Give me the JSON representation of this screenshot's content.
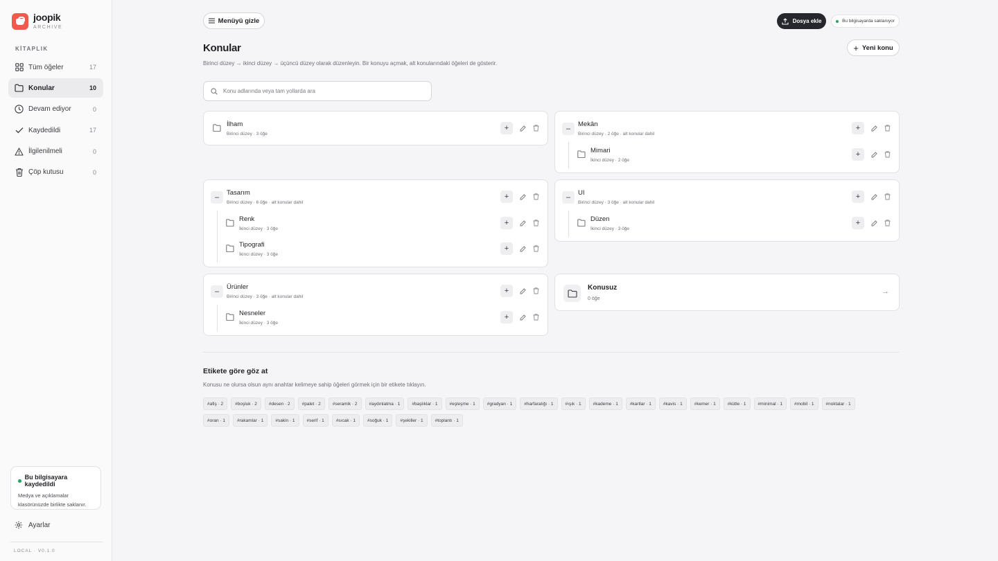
{
  "brand": {
    "name": "joopik",
    "sub": "ARCHIVE"
  },
  "sidebar": {
    "section_label": "KİTAPLIK",
    "items": [
      {
        "label": "Tüm öğeler",
        "count": "17",
        "icon": "grid-icon"
      },
      {
        "label": "Konular",
        "count": "10",
        "icon": "folder-icon",
        "active": true
      },
      {
        "label": "Devam ediyor",
        "count": "0",
        "icon": "clock-icon"
      },
      {
        "label": "Kaydedildi",
        "count": "17",
        "icon": "check-icon"
      },
      {
        "label": "İlgilenilmeli",
        "count": "0",
        "icon": "warning-icon"
      },
      {
        "label": "Çöp kutusu",
        "count": "0",
        "icon": "trash-icon"
      }
    ],
    "save_card": {
      "title": "Bu bilgisayara kaydedildi",
      "desc_line1": "Medya ve açıklamalar",
      "desc_line2": "klasörünüzde birlikte saklanır."
    },
    "settings_label": "Ayarlar",
    "version": "LOCAL · V0.1.0"
  },
  "header": {
    "menu_toggle": "Menüyü gizle",
    "upload": "Dosya ekle",
    "local_badge": "Bu bilgisayarda saklanıyor",
    "title": "Konular",
    "new_topic": "Yeni konu",
    "description": "Birinci düzey → ikinci düzey → üçüncü düzey olarak düzenleyin. Bir konuyu açmak, alt konularındaki öğeleri de gösterir."
  },
  "search": {
    "placeholder": "Konu adlarında veya tam yollarda ara"
  },
  "topics": {
    "ilham": {
      "name": "İlham",
      "meta": "Birinci düzey · 3 öğe"
    },
    "mekan": {
      "name": "Mekân",
      "meta": "Birinci düzey · 2 öğe · alt konular dahil"
    },
    "mimari": {
      "name": "Mimari",
      "meta": "İkinci düzey · 2 öğe"
    },
    "tasarim": {
      "name": "Tasarım",
      "meta": "Birinci düzey · 6 öğe · alt konular dahil"
    },
    "renk": {
      "name": "Renk",
      "meta": "İkinci düzey · 3 öğe"
    },
    "tipografi": {
      "name": "Tipografi",
      "meta": "İkinci düzey · 3 öğe"
    },
    "ui": {
      "name": "UI",
      "meta": "Birinci düzey · 3 öğe · alt konular dahil"
    },
    "duzen": {
      "name": "Düzen",
      "meta": "İkinci düzey · 3 öğe"
    },
    "urunler": {
      "name": "Ürünler",
      "meta": "Birinci düzey · 3 öğe · alt konular dahil"
    },
    "nesneler": {
      "name": "Nesneler",
      "meta": "İkinci düzey · 3 öğe"
    }
  },
  "unlabeled": {
    "name": "Konusuz",
    "meta": "0 öğe"
  },
  "tags_section": {
    "title": "Etikete göre göz at",
    "description": "Konusu ne olursa olsun aynı anahtar kelimeye sahip öğeleri görmek için bir etikete tıklayın.",
    "tags": [
      "#afiş · 2",
      "#boşluk · 2",
      "#desen · 2",
      "#palet · 2",
      "#seramik · 2",
      "#aydınlatma · 1",
      "#başlıklar · 1",
      "#eşleşme · 1",
      "#gradyan · 1",
      "#harfaralığı · 1",
      "#ışık · 1",
      "#kademe · 1",
      "#kartlar · 1",
      "#kavis · 1",
      "#kemer · 1",
      "#kütle · 1",
      "#minimal · 1",
      "#mobil · 1",
      "#noktalar · 1",
      "#oran · 1",
      "#rakamlar · 1",
      "#sakin · 1",
      "#serif · 1",
      "#sıcak · 1",
      "#soğuk · 1",
      "#şekiller · 1",
      "#toplantı · 1"
    ]
  }
}
